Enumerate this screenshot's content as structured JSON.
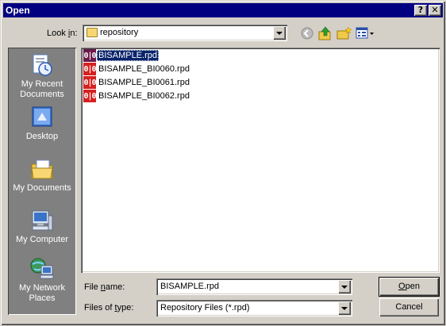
{
  "window": {
    "title": "Open"
  },
  "title_buttons": {
    "help": "?",
    "close": "✕"
  },
  "lookin": {
    "label_pre": "Look ",
    "label_accel": "i",
    "label_post": "n:",
    "value": "repository"
  },
  "toolbar": {
    "icons": [
      "back-icon",
      "up-folder-icon",
      "new-folder-icon",
      "view-menu-icon"
    ]
  },
  "places": [
    {
      "id": "recent",
      "label": "My Recent Documents"
    },
    {
      "id": "desktop",
      "label": "Desktop"
    },
    {
      "id": "documents",
      "label": "My Documents"
    },
    {
      "id": "computer",
      "label": "My Computer"
    },
    {
      "id": "network",
      "label": "My Network Places"
    }
  ],
  "files": [
    {
      "name": "BISAMPLE.rpd",
      "selected": true
    },
    {
      "name": "BISAMPLE_BI0060.rpd",
      "selected": false
    },
    {
      "name": "BISAMPLE_BI0061.rpd",
      "selected": false
    },
    {
      "name": "BISAMPLE_BI0062.rpd",
      "selected": false
    }
  ],
  "file_icon_glyph": "0|0",
  "filename": {
    "label_pre": "File ",
    "label_accel": "n",
    "label_post": "ame:",
    "value": "BISAMPLE.rpd"
  },
  "filetype": {
    "label_pre": "Files of ",
    "label_accel": "t",
    "label_post": "ype:",
    "value": "Repository Files (*.rpd)"
  },
  "buttons": {
    "open_accel": "O",
    "open_rest": "pen",
    "cancel": "Cancel"
  }
}
